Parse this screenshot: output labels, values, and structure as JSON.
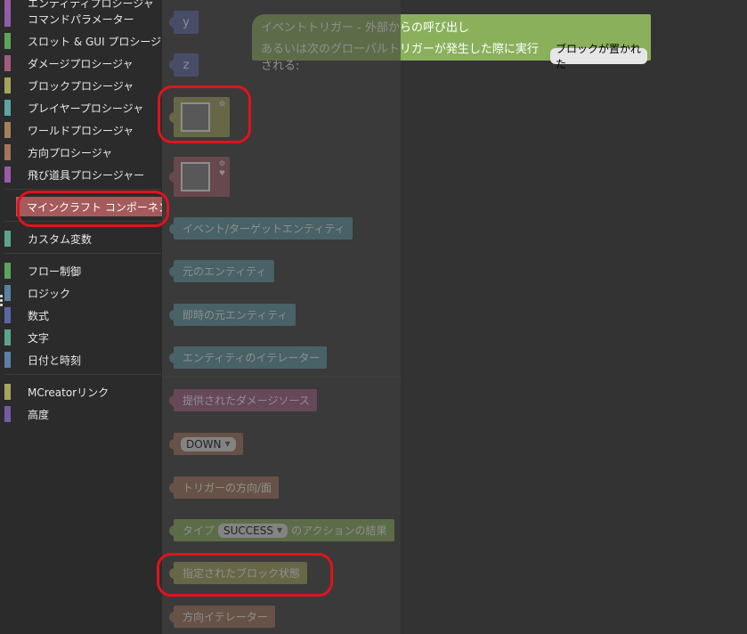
{
  "colors": {
    "background": "#333333",
    "sidebar": "#2b2b2b",
    "flyout": "#3a3a3a",
    "highlight": "#e0131c",
    "selected_category": "#a55b5b"
  },
  "sidebar": {
    "categories": [
      {
        "label": "エンティティプロシージャ",
        "color": "#9a5ca6"
      },
      {
        "label": "コマンドパラメーター",
        "color": "#8e5ea8"
      },
      {
        "label": "スロット & GUI プロシージャ",
        "color": "#5ba55b"
      },
      {
        "label": "ダメージプロシージャ",
        "color": "#a55b80"
      },
      {
        "label": "ブロックプロシージャ",
        "color": "#a5a55b"
      },
      {
        "label": "プレイヤープロシージャ",
        "color": "#5ba5a5"
      },
      {
        "label": "ワールドプロシージャ",
        "color": "#a5805b"
      },
      {
        "label": "方向プロシージャ",
        "color": "#a5745b"
      },
      {
        "label": "飛び道具プロシージャー",
        "color": "#9a5ca6"
      },
      {
        "label": "マインクラフト コンポーネント",
        "color": "#a55b5b",
        "selected": true
      },
      {
        "label": "カスタム変数",
        "color": "#5ba58c"
      },
      {
        "label": "フロー制御",
        "color": "#5ba55b"
      },
      {
        "label": "ロジック",
        "color": "#5b80a5"
      },
      {
        "label": "数式",
        "color": "#5b67a5"
      },
      {
        "label": "文字",
        "color": "#5ba58c"
      },
      {
        "label": "日付と時刻",
        "color": "#5b80a5"
      },
      {
        "label": "MCreatorリンク",
        "color": "#a5a55b"
      },
      {
        "label": "高度",
        "color": "#745ba5"
      }
    ]
  },
  "flyout": {
    "var_y": "y",
    "var_z": "z",
    "event_target_entity": "イベント/ターゲットエンティティ",
    "source_entity": "元のエンティティ",
    "immediate_source_entity": "即時の元エンティティ",
    "entity_iterator": "エンティティのイテレーター",
    "provided_damage_source": "提供されたダメージソース",
    "direction_value": "DOWN",
    "trigger_face": "トリガーの方向/面",
    "action_result_prefix": "タイプ",
    "action_result_value": "SUCCESS",
    "action_result_suffix": "のアクションの結果",
    "specified_blockstate": "指定されたブロック状態",
    "direction_iterator": "方向イテレーター"
  },
  "event_block": {
    "line1": "イベントトリガー - 外部からの呼び出し",
    "line2": "あるいは次のグローバルトリガーが発生した際に実行される:",
    "trigger": "ブロックが置かれた"
  },
  "icons": {
    "block_slot_icon": "⚙",
    "item_slot_icon": "⚙",
    "item_heart_icon": "♥",
    "dropdown_caret": "▼"
  }
}
